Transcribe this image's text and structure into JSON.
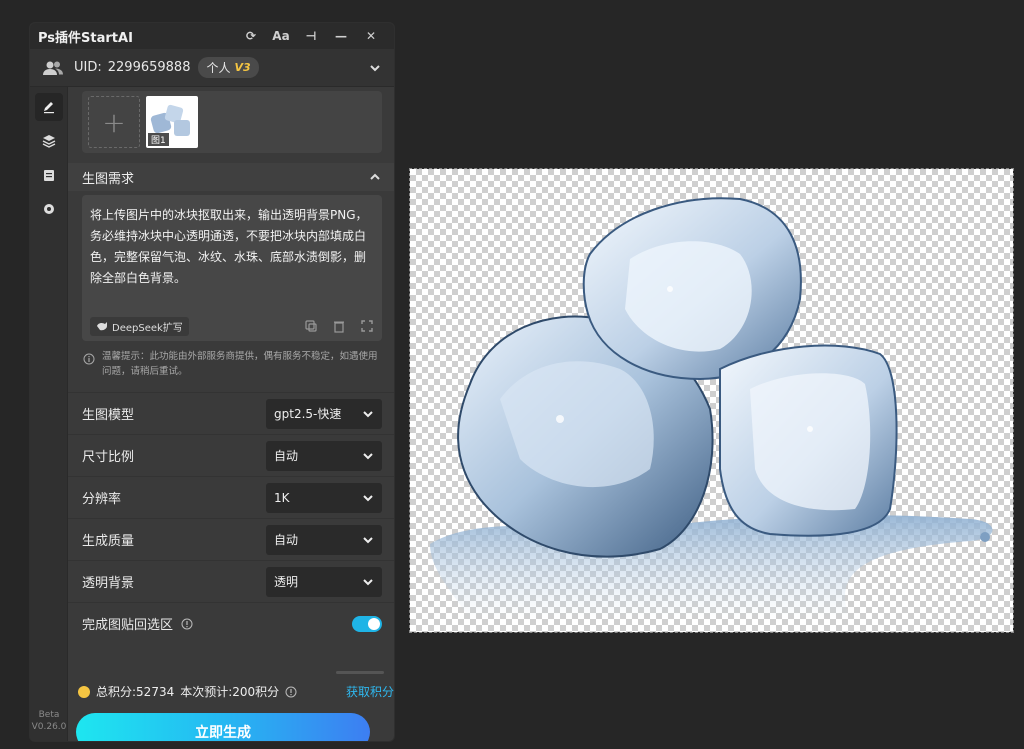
{
  "window": {
    "title": "Ps插件StartAI",
    "btn_refresh": "⟳",
    "btn_font": "Aa",
    "btn_pin": "⊣",
    "btn_min": "—",
    "btn_close": "✕"
  },
  "account": {
    "uid_label": "UID:",
    "uid_value": "2299659888",
    "plan": "个人",
    "vip": "V3"
  },
  "upload": {
    "add_symbol": "+",
    "thumb_label": "图1"
  },
  "prompt_section": {
    "title": "生图需求",
    "text": "将上传图片中的冰块抠取出来，输出透明背景PNG，务必维持冰块中心透明通透，不要把冰块内部填成白色，完整保留气泡、冰纹、水珠、底部水渍倒影，删除全部白色背景。",
    "deepseek_label": "DeepSeek扩写",
    "tip": "温馨提示：此功能由外部服务商提供，偶有服务不稳定，如遇使用问题，请稍后重试。"
  },
  "options": [
    {
      "label": "生图模型",
      "value": "gpt2.5-快速"
    },
    {
      "label": "尺寸比例",
      "value": "自动"
    },
    {
      "label": "分辨率",
      "value": "1K"
    },
    {
      "label": "生成质量",
      "value": "自动"
    },
    {
      "label": "透明背景",
      "value": "透明"
    }
  ],
  "paste_back": {
    "label": "完成图贴回选区",
    "enabled": true
  },
  "footer": {
    "total_credits": "总积分:52734",
    "estimate": "本次预计:200积分",
    "get_credits": "获取积分",
    "generate": "立即生成"
  },
  "version": {
    "stage": "Beta",
    "number": "V0.26.0"
  },
  "colors": {
    "accent": "#1fb4e6",
    "gen_gradient_start": "#1ee6f0",
    "gen_gradient_end": "#3d7ef2",
    "coin": "#f5c542"
  },
  "icons": {
    "sidebar": [
      "edit-icon",
      "layers-icon",
      "clipboard-icon",
      "settings-icon"
    ]
  }
}
